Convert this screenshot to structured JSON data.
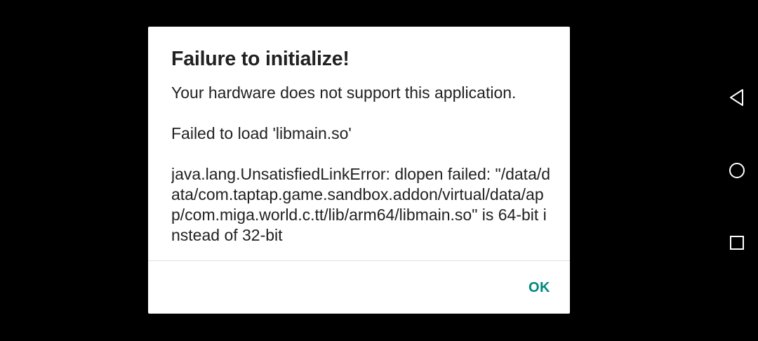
{
  "dialog": {
    "title": "Failure to initialize!",
    "message_hardware": "Your hardware does not support this application.",
    "message_load": "Failed to load 'libmain.so'",
    "message_error": "java.lang.UnsatisfiedLinkError: dlopen failed: \"/data/data/com.taptap.game.sandbox.addon/virtual/data/app/com.miga.world.c.tt/lib/arm64/libmain.so\" is 64-bit instead of 32-bit",
    "ok_label": "OK"
  },
  "nav_bar": {
    "back_icon": "back-triangle-icon",
    "home_icon": "home-circle-icon",
    "recents_icon": "recents-square-icon"
  },
  "colors": {
    "background": "#000000",
    "dialog_bg": "#ffffff",
    "text": "#212121",
    "accent": "#00897B",
    "nav_icon": "#ffffff"
  }
}
